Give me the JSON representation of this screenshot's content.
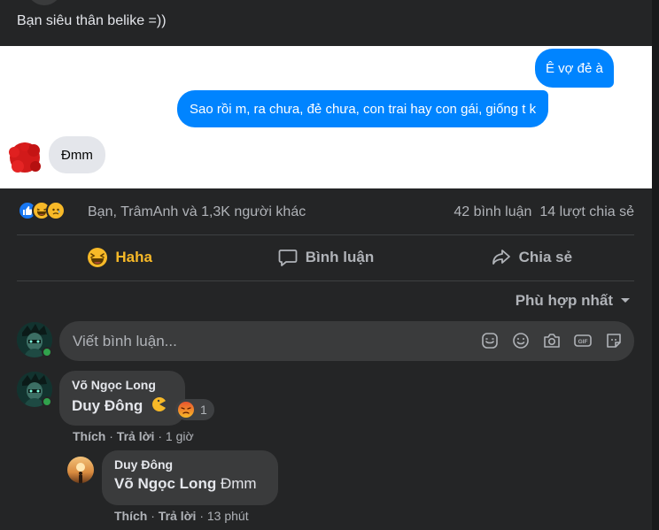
{
  "post": {
    "caption": "Bạn siêu thân belike =))"
  },
  "chat": {
    "msg1": "Ê vợ đẻ à",
    "msg2": "Sao rồi m, ra chưa, đẻ chưa, con trai hay con gái, giống t k",
    "reply": "Đmm"
  },
  "stats": {
    "likes": "Bạn, TrâmAnh và 1,3K người khác",
    "comments": "42 bình luận",
    "shares": "14 lượt chia sẻ",
    "reaction_icons": [
      "like-icon",
      "haha-icon",
      "sad-icon"
    ]
  },
  "actions": {
    "haha": "Haha",
    "comment": "Bình luận",
    "share": "Chia sẻ"
  },
  "sort": {
    "label": "Phù hợp nhất"
  },
  "composer": {
    "placeholder": "Viết bình luận...",
    "icons": [
      "sticker-icon",
      "emoji-icon",
      "camera-icon",
      "gif-icon",
      "avatar-sticker-icon"
    ]
  },
  "comments": [
    {
      "author": "Võ Ngọc Long",
      "mention": "Duy Đông",
      "text": "",
      "reaction_count": "1",
      "like": "Thích",
      "reply": "Trả lời",
      "time": "1 giờ"
    },
    {
      "author": "Duy Đông",
      "mention": "Võ Ngọc Long",
      "text": "Đmm",
      "like": "Thích",
      "reply": "Trả lời",
      "time": "13 phút"
    }
  ],
  "colors": {
    "background": "#242526",
    "messenger_blue": "#0084ff",
    "haha_yellow": "#f7b928",
    "online_green": "#31a24c"
  }
}
